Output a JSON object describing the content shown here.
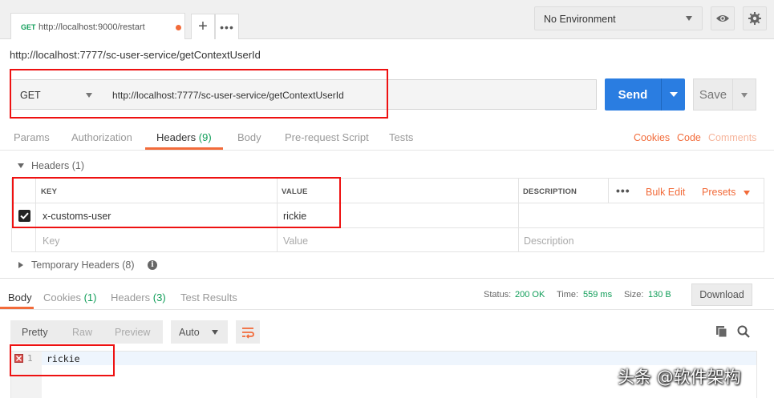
{
  "request_tab": {
    "method": "GET",
    "url": "http://localhost:9000/restart"
  },
  "environment": {
    "selected": "No Environment"
  },
  "request_name": "http://localhost:7777/sc-user-service/getContextUserId",
  "url_bar": {
    "method": "GET",
    "url": "http://localhost:7777/sc-user-service/getContextUserId",
    "send_label": "Send",
    "save_label": "Save"
  },
  "request_tabs": [
    {
      "label": "Params"
    },
    {
      "label": "Authorization"
    },
    {
      "label": "Headers",
      "count": "(9)"
    },
    {
      "label": "Body"
    },
    {
      "label": "Pre-request Script"
    },
    {
      "label": "Tests"
    }
  ],
  "request_links": {
    "cookies": "Cookies",
    "code": "Code",
    "comments": "Comments"
  },
  "headers_section": {
    "title": "Headers",
    "count": "(1)",
    "columns": {
      "key": "KEY",
      "value": "VALUE",
      "description": "DESCRIPTION"
    },
    "bulk_edit": "Bulk Edit",
    "presets": "Presets",
    "rows": [
      {
        "key": "x-customs-user",
        "value": "rickie",
        "description": ""
      }
    ],
    "placeholders": {
      "key": "Key",
      "value": "Value",
      "description": "Description"
    }
  },
  "temporary_headers": {
    "title": "Temporary Headers",
    "count": "(8)"
  },
  "response_tabs": [
    {
      "label": "Body"
    },
    {
      "label": "Cookies",
      "count": "(1)"
    },
    {
      "label": "Headers",
      "count": "(3)"
    },
    {
      "label": "Test Results"
    }
  ],
  "response_status": {
    "status_label": "Status:",
    "status_value": "200 OK",
    "time_label": "Time:",
    "time_value": "559 ms",
    "size_label": "Size:",
    "size_value": "130 B",
    "download_label": "Download"
  },
  "view_modes": {
    "pretty": "Pretty",
    "raw": "Raw",
    "preview": "Preview",
    "format": "Auto"
  },
  "response_body": {
    "line_number": "1",
    "text": "rickie"
  },
  "watermark": "头条 @软件架构",
  "colors": {
    "accent": "#f26b3a",
    "send": "#2a7de1",
    "success": "#0f9d58",
    "highlight_box": "#ee1111"
  }
}
